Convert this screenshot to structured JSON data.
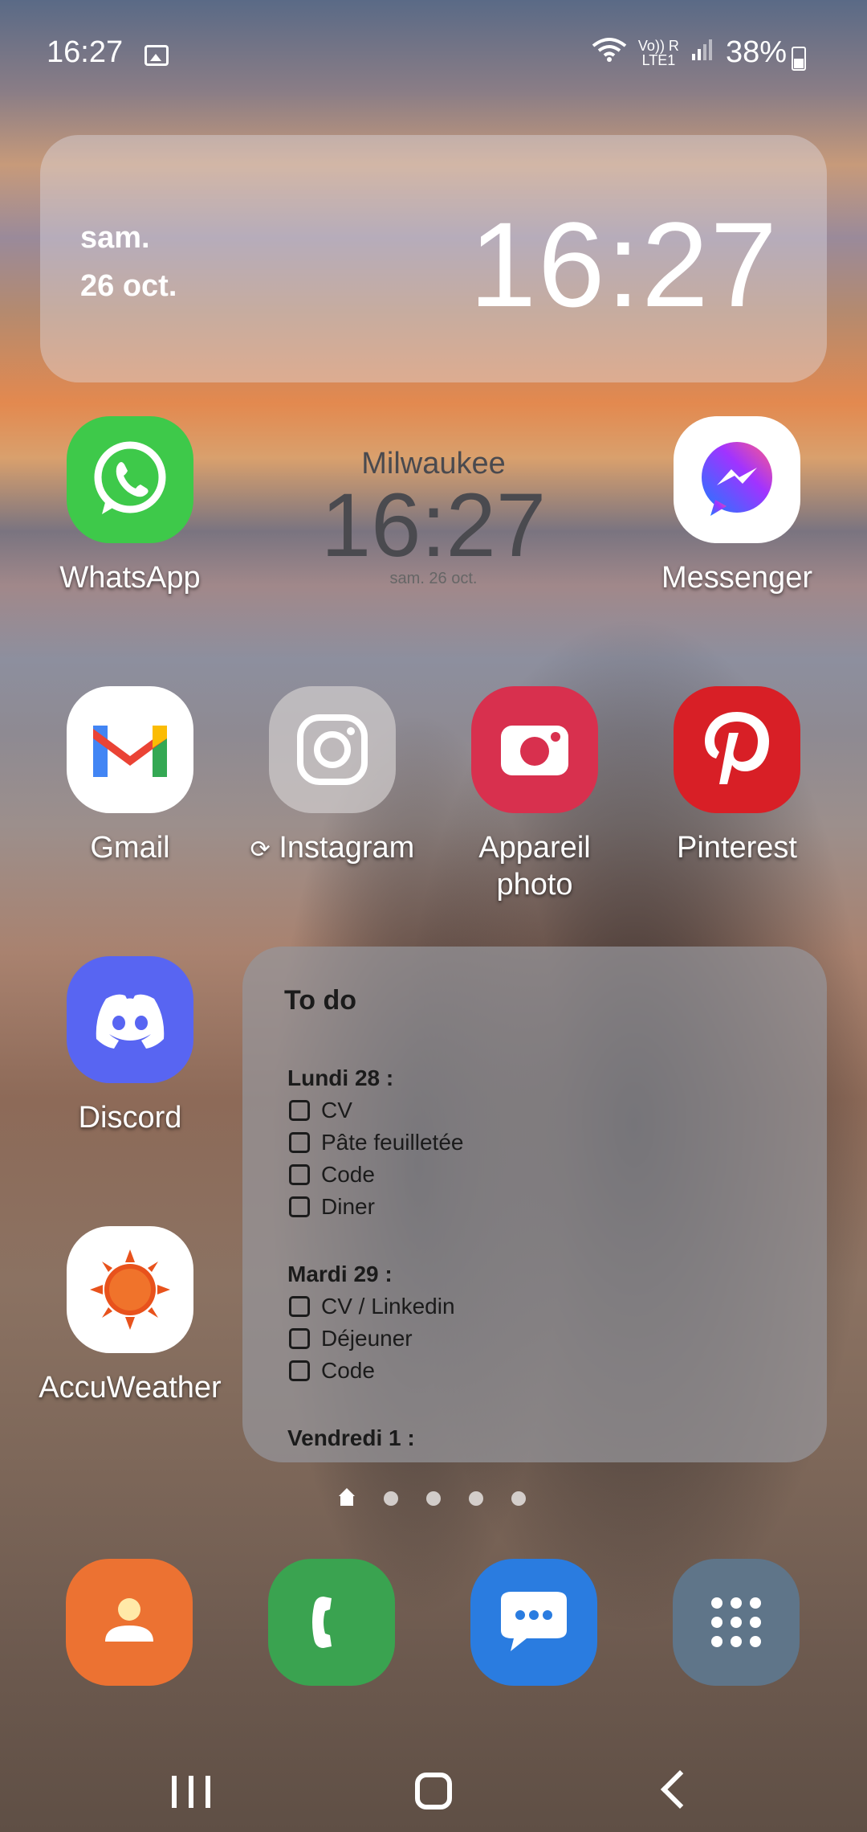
{
  "status_bar": {
    "time": "16:27",
    "battery": "38%",
    "icons": [
      "gallery-notification-icon",
      "wifi-icon",
      "volte-lte-icon",
      "signal-icon",
      "battery-icon"
    ],
    "volte_label": "Vo)) R",
    "lte_label": "LTE1"
  },
  "clock_widget": {
    "day": "sam.",
    "date": "26 oct.",
    "time": "16:27"
  },
  "world_clock": {
    "city": "Milwaukee",
    "time": "16:27",
    "date": "sam. 26 oct."
  },
  "apps": {
    "whatsapp": "WhatsApp",
    "messenger": "Messenger",
    "gmail": "Gmail",
    "instagram": "Instagram",
    "camera_line1": "Appareil",
    "camera_line2": "photo",
    "pinterest": "Pinterest",
    "discord": "Discord",
    "accuweather": "AccuWeather"
  },
  "todo": {
    "title": "To do",
    "sections": [
      {
        "heading": "Lundi 28 :",
        "items": [
          "CV",
          "Pâte feuilletée",
          "Code",
          "Diner"
        ]
      },
      {
        "heading": "Mardi 29 :",
        "items": [
          "CV / Linkedin",
          "Déjeuner",
          "Code"
        ]
      },
      {
        "heading": "Vendredi 1 :",
        "items": []
      }
    ]
  },
  "colors": {
    "whatsapp": "#3ec94a",
    "gmail_bg": "#ffffff",
    "camera": "#d8304e",
    "pinterest": "#d81f26",
    "discord": "#5865f2",
    "contacts": "#ec7232",
    "phone": "#3aa350",
    "messages": "#2a7ce0",
    "apps": "#5f7589"
  },
  "dock": [
    "contacts-icon",
    "phone-icon",
    "messages-icon",
    "app-drawer-icon"
  ]
}
